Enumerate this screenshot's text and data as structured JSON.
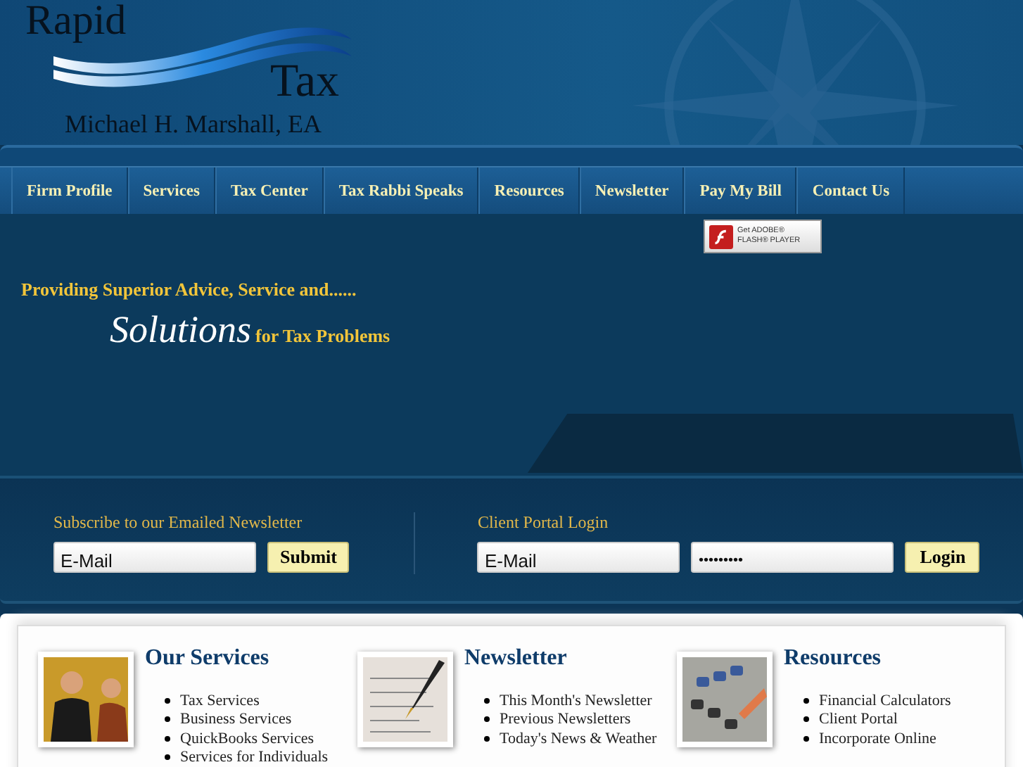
{
  "logo": {
    "word_1": "Rapid",
    "word_2": "Tax",
    "owner": "Michael H. Marshall, EA"
  },
  "nav": [
    {
      "label": "Firm Profile"
    },
    {
      "label": "Services"
    },
    {
      "label": "Tax Center"
    },
    {
      "label": "Tax Rabbi Speaks"
    },
    {
      "label": "Resources"
    },
    {
      "label": "Newsletter"
    },
    {
      "label": "Pay My Bill"
    },
    {
      "label": "Contact Us"
    }
  ],
  "flash_badge": {
    "line_1": "Get ADOBE®",
    "line_2": "FLASH® PLAYER"
  },
  "hero": {
    "tagline": "Providing Superior Advice, Service and......",
    "big_word": "Solutions",
    "rest": "for Tax Problems"
  },
  "newsletter_form": {
    "title": "Subscribe to our Emailed Newsletter",
    "email_value": "E-Mail",
    "button": "Submit"
  },
  "login_form": {
    "title": "Client Portal Login",
    "email_value": "E-Mail",
    "password_value": "•••••••••",
    "button": "Login"
  },
  "sections": [
    {
      "kind": "people",
      "title": "Our Services",
      "items": [
        "Tax Services",
        "Business Services",
        "QuickBooks Services",
        "Services for Individuals"
      ]
    },
    {
      "kind": "pen",
      "title": "Newsletter",
      "items": [
        "This Month's Newsletter",
        "Previous Newsletters",
        "Today's News & Weather"
      ]
    },
    {
      "kind": "calculator",
      "title": "Resources",
      "items": [
        "Financial Calculators",
        "Client Portal",
        "Incorporate Online"
      ]
    }
  ]
}
